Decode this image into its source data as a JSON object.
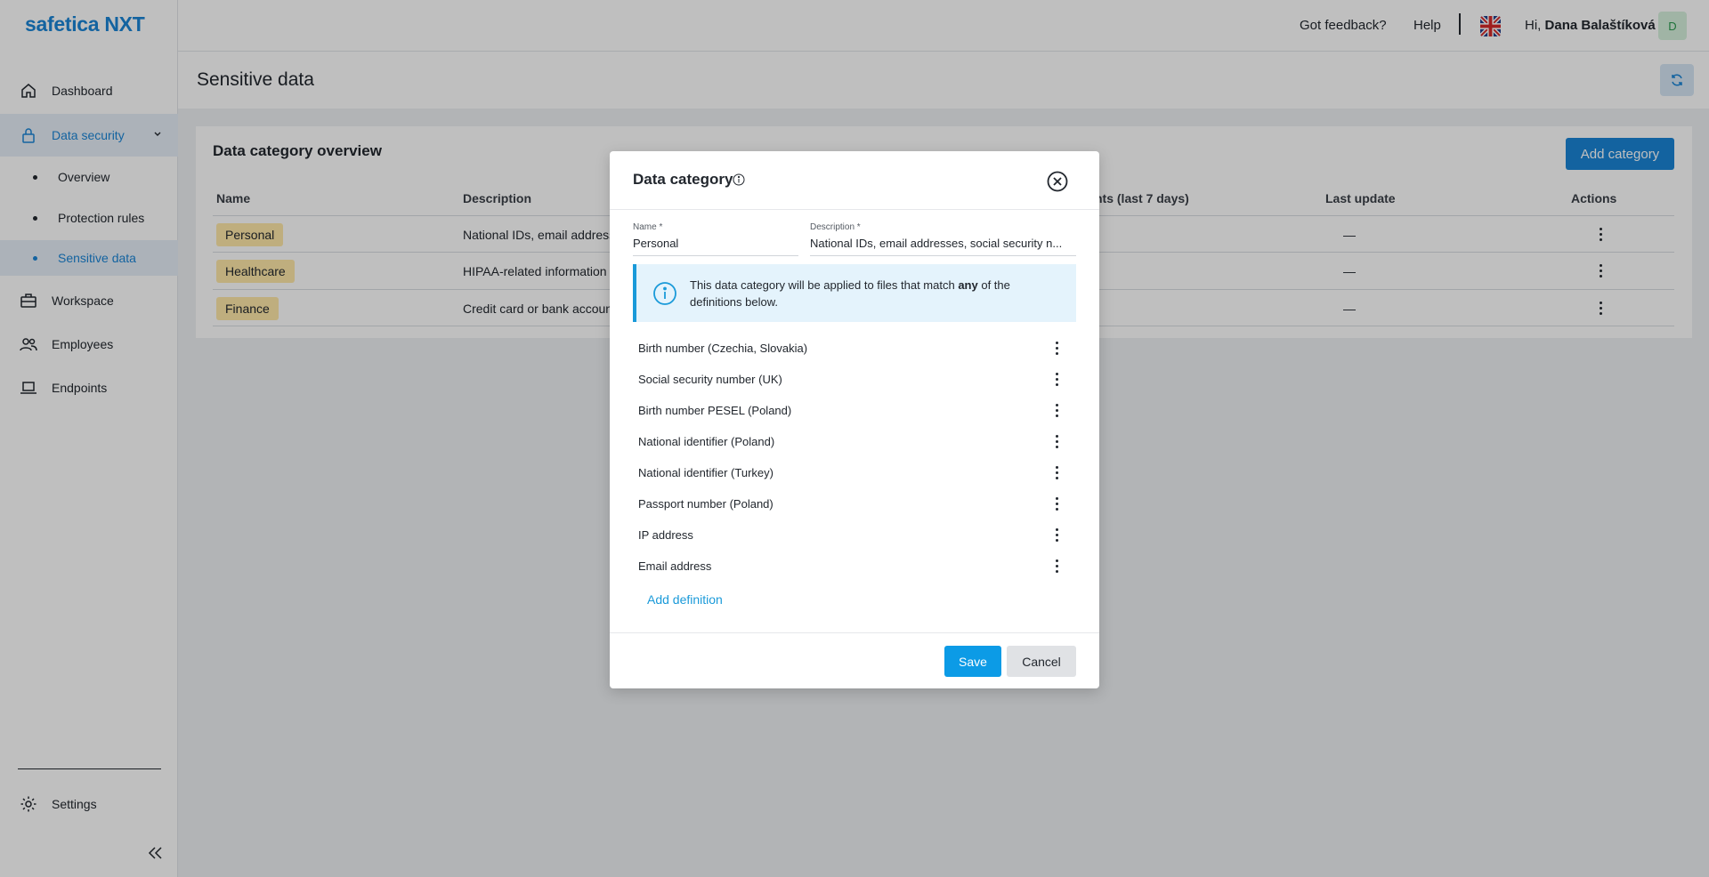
{
  "app": {
    "logo": "safetica NXT"
  },
  "sidebar": {
    "items": [
      {
        "label": "Dashboard",
        "icon": "home-icon"
      },
      {
        "label": "Data security",
        "icon": "lock-icon"
      },
      {
        "label": "Workspace",
        "icon": "briefcase-icon"
      },
      {
        "label": "Employees",
        "icon": "users-icon"
      },
      {
        "label": "Endpoints",
        "icon": "laptop-icon"
      }
    ],
    "sub_items": [
      "Overview",
      "Protection rules",
      "Sensitive data"
    ],
    "settings": "Settings"
  },
  "header": {
    "feedback": "Got feedback?",
    "help": "Help",
    "greeting": "Hi,",
    "user_name": "Dana Balaštíková",
    "avatar_initial": "D"
  },
  "page": {
    "title": "Sensitive data"
  },
  "overview": {
    "title": "Data category overview",
    "add_button": "Add category",
    "columns": [
      "Name",
      "Description",
      "nts (last 7 days)",
      "Last update",
      "Actions"
    ],
    "rows": [
      {
        "name": "Personal",
        "description": "National IDs, email address",
        "last_update": "—"
      },
      {
        "name": "Healthcare",
        "description": "HIPAA-related information",
        "last_update": "—"
      },
      {
        "name": "Finance",
        "description": "Credit card or bank accoun",
        "last_update": "—"
      }
    ]
  },
  "modal": {
    "title": "Data category",
    "name_label": "Name *",
    "name_value": "Personal",
    "description_label": "Description *",
    "description_value": "National IDs, email addresses, social security n...",
    "info_text_before": "This data category will be applied to files that match ",
    "info_text_bold": "any",
    "info_text_after": " of the definitions below.",
    "definitions": [
      "Birth number (Czechia, Slovakia)",
      "Social security number (UK)",
      "Birth number PESEL (Poland)",
      "National identifier (Poland)",
      "National identifier (Turkey)",
      "Passport number (Poland)",
      "IP address",
      "Email address"
    ],
    "add_definition": "Add definition",
    "save": "Save",
    "cancel": "Cancel"
  },
  "colors": {
    "accent": "#1a85d6",
    "tag": "#ffe9a8",
    "info_bg": "#e4f3fc"
  }
}
